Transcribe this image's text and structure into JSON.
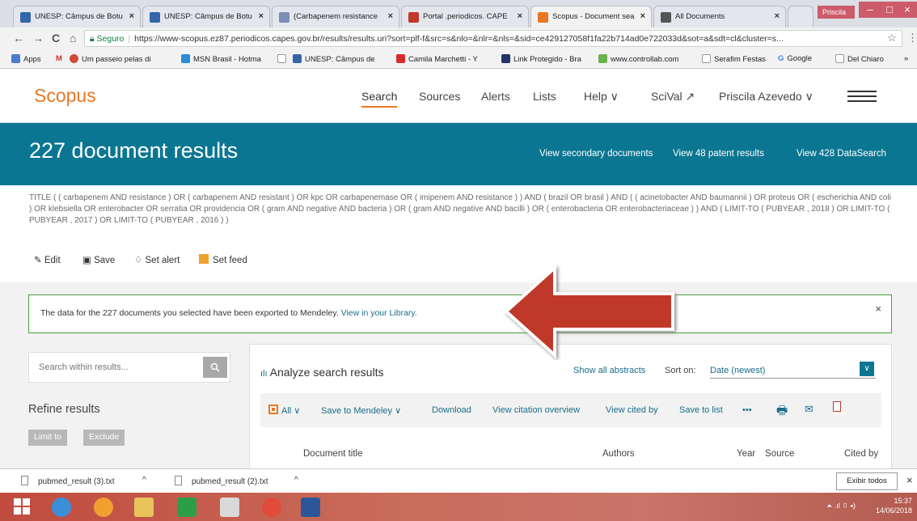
{
  "browser": {
    "tabs": [
      {
        "title": "UNESP: Câmpus de Botu",
        "fav_color": "#3366aa"
      },
      {
        "title": "UNESP: Câmpus de Botu",
        "fav_color": "#3366aa"
      },
      {
        "title": "(Carbapenem resistance",
        "fav_color": "#7a8db5"
      },
      {
        "title": "Portal .periodicos. CAPE",
        "fav_color": "#c0392b"
      },
      {
        "title": "Scopus - Document sea",
        "fav_color": "#e87722"
      },
      {
        "title": "All Documents",
        "fav_color": "#555555"
      }
    ],
    "close_glyph": "×",
    "profile_name": "Priscila",
    "window_controls": [
      "–",
      "□",
      "×"
    ],
    "nav": {
      "back": "←",
      "forward": "→",
      "reload": "C",
      "home": "⌂"
    },
    "secure_label": "Seguro",
    "url": "https://www-scopus.ez87.periodicos.capes.gov.br/results/results.uri?sort=plf-f&src=s&nlo=&nlr=&nls=&sid=ce429127058f1fa22b714ad0e722033d&sot=a&sdt=cl&cluster=s...",
    "star": "☆",
    "more": "⋮",
    "bookmarks": [
      {
        "label": "Apps",
        "icon_color": "#4a7bd0"
      },
      {
        "label": "M",
        "icon_color": "#ffffff"
      },
      {
        "label": "Um passeio pelas di",
        "icon_color": "#d04b3a"
      },
      {
        "label": "MSN Brasil - Hotma",
        "icon_color": "#2a8bd8"
      },
      {
        "label": "",
        "icon_color": "#cccccc"
      },
      {
        "label": "UNESP: Câmpus de",
        "icon_color": "#3366aa"
      },
      {
        "label": "Camila Marchetti - Y",
        "icon_color": "#d62b2b"
      },
      {
        "label": "Link Protegido - Bra",
        "icon_color": "#223366"
      },
      {
        "label": "www.controllab.com",
        "icon_color": "#6ab04c"
      },
      {
        "label": "Serafim Festas",
        "icon_color": "#cccccc"
      },
      {
        "label": "Google",
        "icon_color": "#ffffff"
      },
      {
        "label": "Del Chiaro",
        "icon_color": "#cccccc"
      }
    ],
    "bookmarks_more": "»"
  },
  "scopus": {
    "logo": "Scopus",
    "nav": {
      "search": "Search",
      "sources": "Sources",
      "alerts": "Alerts",
      "lists": "Lists",
      "help": "Help ∨",
      "scival": "SciVal ↗",
      "user": "Priscila Azevedo ∨"
    },
    "brand_color": "#e87722",
    "banner_color": "#0a7692"
  },
  "results": {
    "title": "227 document results",
    "links": {
      "secondary": "View secondary documents",
      "patents": "View 48 patent results",
      "datasearch": "View 428 DataSearch"
    },
    "query": "TITLE ( ( carbapenem AND resistance ) OR ( carbapenem AND resistant ) OR kpc OR carbapenemase OR ( imipenem AND resistance ) ) AND ( brazil OR brasil ) AND ( ( acinetobacter AND baumannii ) OR proteus OR ( escherichia AND coli ) OR klebsiella OR enterobacter OR serratia OR providencia OR ( gram AND negative AND bacteria ) OR ( gram AND negative AND bacilli ) OR ( enterobacteria OR enterobacteriaceae ) ) AND ( LIMIT-TO ( PUBYEAR , 2018 ) OR LIMIT-TO ( PUBYEAR , 2017 ) OR LIMIT-TO ( PUBYEAR , 2016 ) )",
    "actions": {
      "edit": "Edit",
      "save": "Save",
      "set_alert": "Set alert",
      "set_feed": "Set feed"
    },
    "alert": {
      "text": "The data for the 227 documents you selected have been exported to Mendeley.",
      "link": "View in your Library.",
      "close": "×"
    }
  },
  "refine": {
    "search_placeholder": "Search within results...",
    "search_icon": "search-icon",
    "title": "Refine results",
    "limit_to": "Limit to",
    "exclude": "Exclude"
  },
  "analysis": {
    "analyze": "Analyze search results",
    "show_abstracts": "Show all abstracts",
    "sort_label": "Sort on:",
    "sort_value": "Date (newest)",
    "sort_chevron": "∨",
    "toolbar": {
      "all": "All ∨",
      "save_to_mendeley": "Save to Mendeley ∨",
      "download": "Download",
      "citation_overview": "View citation overview",
      "cited_by": "View cited by",
      "save_to_list": "Save to list",
      "more": "•••"
    },
    "columns": [
      "Document title",
      "Authors",
      "Year",
      "Source",
      "Cited by"
    ]
  },
  "downloads": {
    "items": [
      "pubmed_result (3).txt",
      "pubmed_result (2).txt"
    ],
    "chevron": "^",
    "show_all": "Exibir todos",
    "close": "×"
  },
  "taskbar": {
    "time": "15:37",
    "date": "14/06/2018",
    "tray": "⏶ .ıl ▯ ◂)",
    "icons": [
      {
        "name": "windows-start-icon",
        "color": "#ffffff"
      },
      {
        "name": "internet-explorer-icon",
        "color": "#3b8fd9"
      },
      {
        "name": "media-player-icon",
        "color": "#f0a030"
      },
      {
        "name": "file-explorer-icon",
        "color": "#e8c45a"
      },
      {
        "name": "store-icon",
        "color": "#2c9e4a"
      },
      {
        "name": "paint-icon",
        "color": "#d9d9d9"
      },
      {
        "name": "chrome-icon",
        "color": "#e04b3a"
      },
      {
        "name": "word-icon",
        "color": "#2b579a"
      }
    ]
  },
  "annotation": {
    "arrow_color": "#c0392b"
  }
}
